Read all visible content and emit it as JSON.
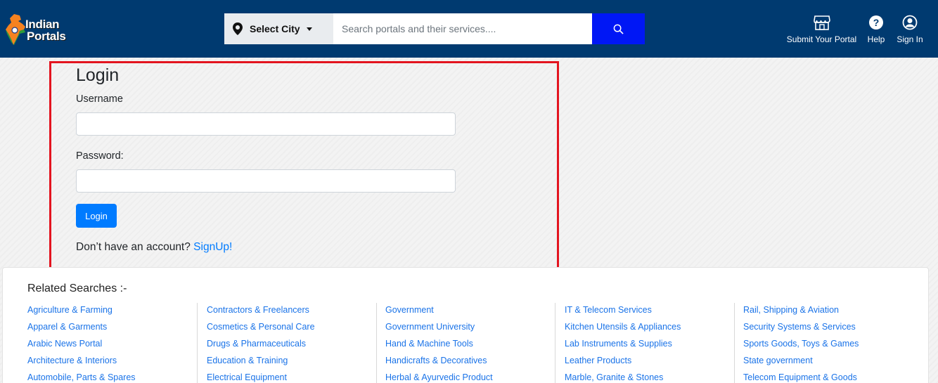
{
  "header": {
    "logo_line1": "Indian",
    "logo_line2": "Portals",
    "city_select_label": "Select City",
    "search_placeholder": "Search portals and their services....",
    "nav": [
      {
        "label": "Submit Your Portal",
        "icon": "store-icon"
      },
      {
        "label": "Help",
        "icon": "help-icon"
      },
      {
        "label": "Sign In",
        "icon": "user-circle-icon"
      }
    ]
  },
  "login": {
    "title": "Login",
    "username_label": "Username",
    "username_value": "",
    "password_label": "Password:",
    "password_value": "",
    "button_label": "Login",
    "signup_prompt": "Don’t have an account? ",
    "signup_link": "SignUp!"
  },
  "related": {
    "title": "Related Searches :-",
    "columns": [
      [
        "Agriculture & Farming",
        "Apparel & Garments",
        "Arabic News Portal",
        "Architecture & Interiors",
        "Automobile, Parts & Spares"
      ],
      [
        "Contractors & Freelancers",
        "Cosmetics & Personal Care",
        "Drugs & Pharmaceuticals",
        "Education & Training",
        "Electrical Equipment"
      ],
      [
        "Government",
        "Government University",
        "Hand & Machine Tools",
        "Handicrafts & Decoratives",
        "Herbal & Ayurvedic Product"
      ],
      [
        "IT & Telecom Services",
        "Kitchen Utensils & Appliances",
        "Lab Instruments & Supplies",
        "Leather Products",
        "Marble, Granite & Stones"
      ],
      [
        "Rail, Shipping & Aviation",
        "Security Systems & Services",
        "Sports Goods, Toys & Games",
        "State government",
        "Telecom Equipment & Goods"
      ]
    ]
  },
  "colors": {
    "header_bg": "#003a70",
    "search_button": "#0017f5",
    "highlight_border": "#e3141f",
    "link": "#1a73e8",
    "primary_button": "#007bff"
  }
}
